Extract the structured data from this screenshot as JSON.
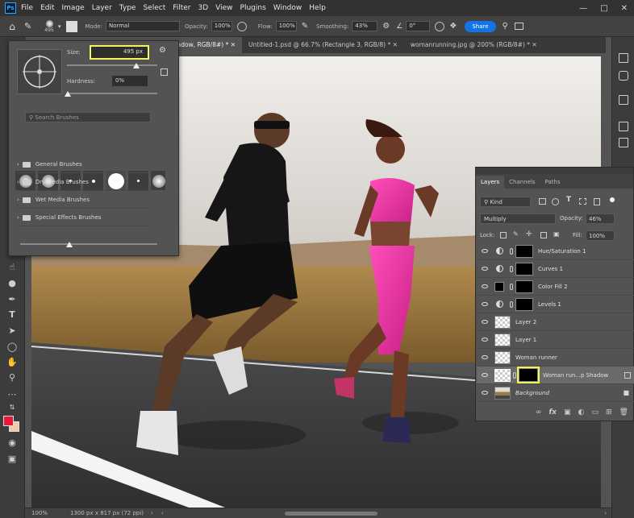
{
  "menu": {
    "logo": "Ps",
    "items": [
      "File",
      "Edit",
      "Image",
      "Layer",
      "Type",
      "Select",
      "Filter",
      "3D",
      "View",
      "Plugins",
      "Window",
      "Help"
    ]
  },
  "options": {
    "brush_size_small": "495",
    "mode_label": "Mode:",
    "mode_value": "Normal",
    "opacity_label": "Opacity:",
    "opacity_value": "100%",
    "flow_label": "Flow:",
    "flow_value": "100%",
    "smoothing_label": "Smoothing:",
    "smoothing_value": "43%",
    "angle_value": "0°",
    "share_label": "Share"
  },
  "tabs": [
    {
      "label": "p Shadow, RGB/8#) *",
      "active": true
    },
    {
      "label": "Untitled-1.psd @ 66.7% (Rectangle 3, RGB/8) *",
      "active": false
    },
    {
      "label": "womanrunning.jpg @ 200% (RGB/8#) *",
      "active": false
    }
  ],
  "brush_popup": {
    "size_label": "Size:",
    "size_value": "495 px",
    "hardness_label": "Hardness:",
    "hardness_value": "0%",
    "search_placeholder": "Search Brushes",
    "folders": [
      "General Brushes",
      "Dry Media Brushes",
      "Wet Media Brushes",
      "Special Effects Brushes"
    ]
  },
  "layers_panel": {
    "tabs": [
      "Layers",
      "Channels",
      "Paths"
    ],
    "filter_kind": "Kind",
    "blend_mode": "Multiply",
    "opacity_label": "Opacity:",
    "opacity_value": "46%",
    "lock_label": "Lock:",
    "fill_label": "Fill:",
    "fill_value": "100%",
    "layers": [
      {
        "name": "Hue/Saturation 1",
        "type": "adjustment"
      },
      {
        "name": "Curves 1",
        "type": "adjustment"
      },
      {
        "name": "Color Fill 2",
        "type": "fill"
      },
      {
        "name": "Levels 1",
        "type": "adjustment"
      },
      {
        "name": "Layer 2",
        "type": "pixel"
      },
      {
        "name": "Layer 1",
        "type": "pixel"
      },
      {
        "name": "Woman runner",
        "type": "pixel"
      },
      {
        "name": "Woman run...p Shadow",
        "type": "masked",
        "selected": true
      },
      {
        "name": "Background",
        "type": "background"
      }
    ]
  },
  "status": {
    "zoom": "100%",
    "doc_info": "1300 px x 817 px (72 ppi)"
  },
  "colors": {
    "foreground": "#e8183c",
    "background": "#f1c9a7",
    "highlight": "#f7f25a",
    "accent": "#1473e6"
  }
}
